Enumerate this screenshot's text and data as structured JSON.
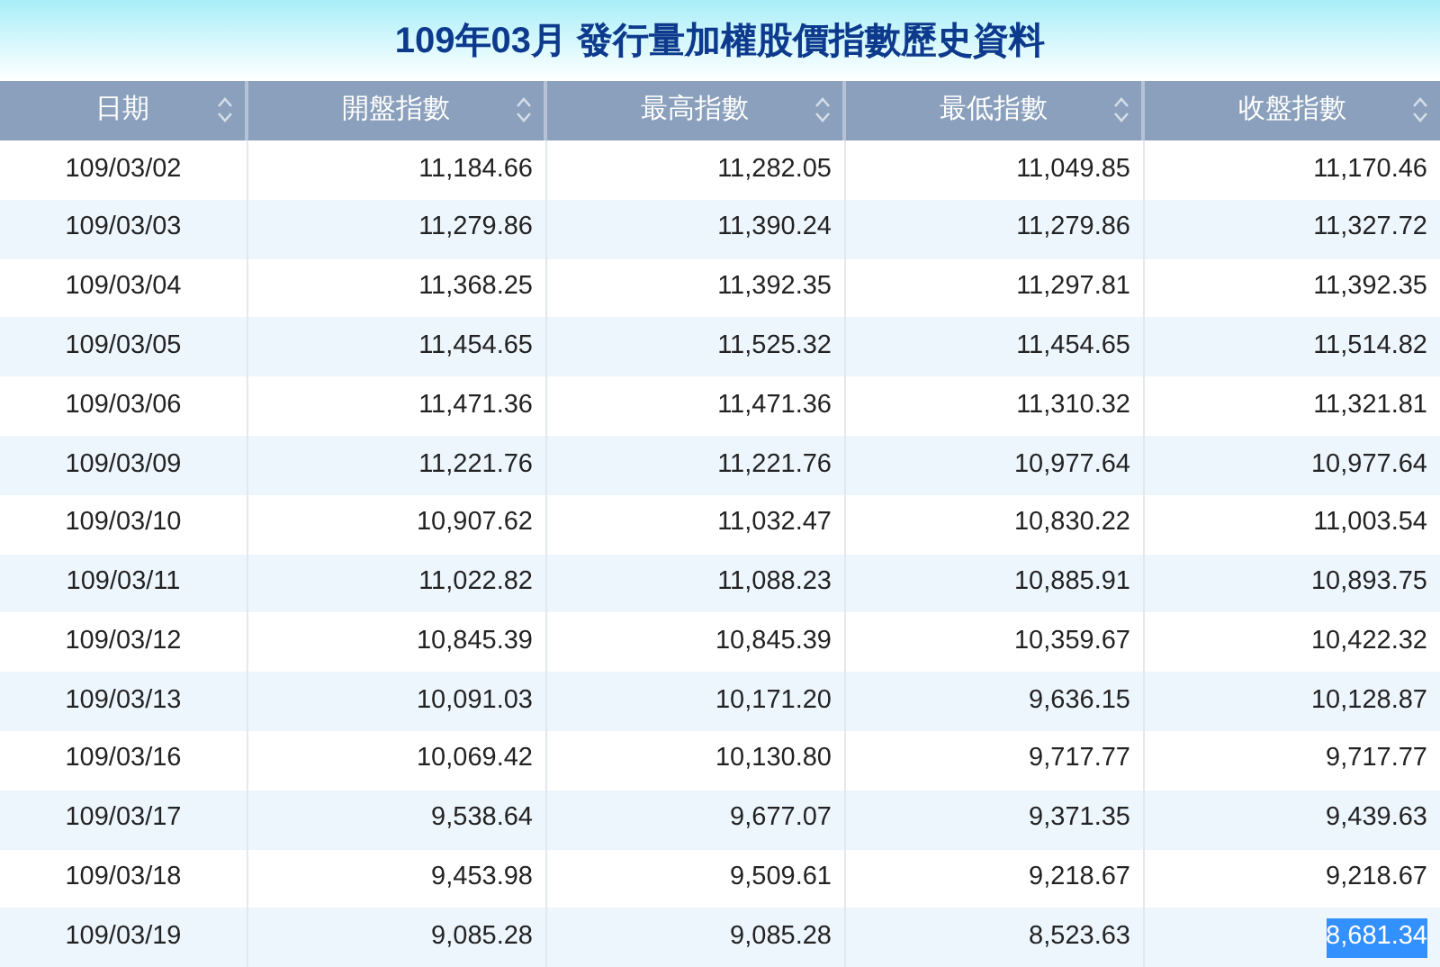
{
  "title": "109年03月 發行量加權股價指數歷史資料",
  "columns": [
    "日期",
    "開盤指數",
    "最高指數",
    "最低指數",
    "收盤指數"
  ],
  "rows": [
    {
      "cells": [
        "109/03/02",
        "11,184.66",
        "11,282.05",
        "11,049.85",
        "11,170.46"
      ],
      "close_highlighted": false
    },
    {
      "cells": [
        "109/03/03",
        "11,279.86",
        "11,390.24",
        "11,279.86",
        "11,327.72"
      ],
      "close_highlighted": false
    },
    {
      "cells": [
        "109/03/04",
        "11,368.25",
        "11,392.35",
        "11,297.81",
        "11,392.35"
      ],
      "close_highlighted": false
    },
    {
      "cells": [
        "109/03/05",
        "11,454.65",
        "11,525.32",
        "11,454.65",
        "11,514.82"
      ],
      "close_highlighted": false
    },
    {
      "cells": [
        "109/03/06",
        "11,471.36",
        "11,471.36",
        "11,310.32",
        "11,321.81"
      ],
      "close_highlighted": false
    },
    {
      "cells": [
        "109/03/09",
        "11,221.76",
        "11,221.76",
        "10,977.64",
        "10,977.64"
      ],
      "close_highlighted": false
    },
    {
      "cells": [
        "109/03/10",
        "10,907.62",
        "11,032.47",
        "10,830.22",
        "11,003.54"
      ],
      "close_highlighted": false
    },
    {
      "cells": [
        "109/03/11",
        "11,022.82",
        "11,088.23",
        "10,885.91",
        "10,893.75"
      ],
      "close_highlighted": false
    },
    {
      "cells": [
        "109/03/12",
        "10,845.39",
        "10,845.39",
        "10,359.67",
        "10,422.32"
      ],
      "close_highlighted": false
    },
    {
      "cells": [
        "109/03/13",
        "10,091.03",
        "10,171.20",
        "9,636.15",
        "10,128.87"
      ],
      "close_highlighted": false
    },
    {
      "cells": [
        "109/03/16",
        "10,069.42",
        "10,130.80",
        "9,717.77",
        "9,717.77"
      ],
      "close_highlighted": false
    },
    {
      "cells": [
        "109/03/17",
        "9,538.64",
        "9,677.07",
        "9,371.35",
        "9,439.63"
      ],
      "close_highlighted": false
    },
    {
      "cells": [
        "109/03/18",
        "9,453.98",
        "9,509.61",
        "9,218.67",
        "9,218.67"
      ],
      "close_highlighted": false
    },
    {
      "cells": [
        "109/03/19",
        "9,085.28",
        "9,085.28",
        "8,523.63",
        "8,681.34"
      ],
      "close_highlighted": true
    }
  ]
}
